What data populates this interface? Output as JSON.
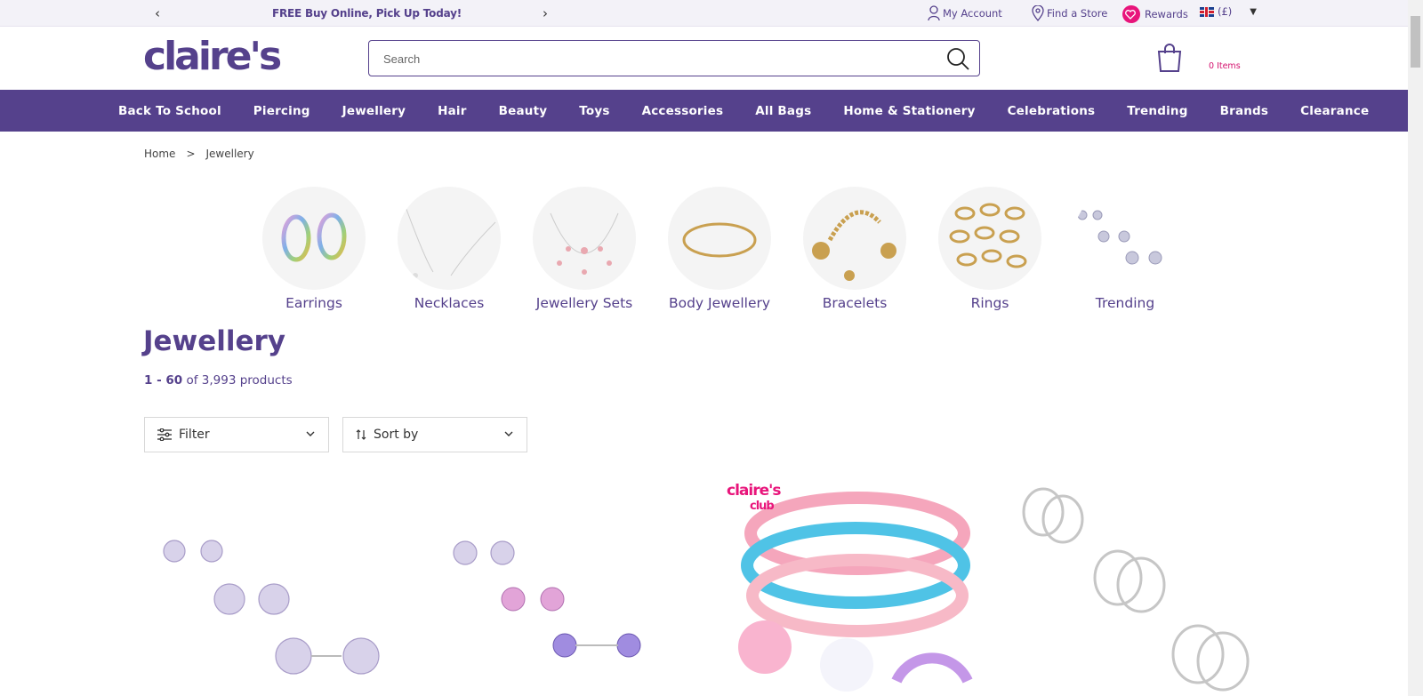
{
  "promo": {
    "message": "FREE Buy Online, Pick Up Today!",
    "prev": "‹",
    "next": "›"
  },
  "utility": {
    "account": "My Account",
    "store": "Find a Store",
    "rewards": "Rewards",
    "currency": "(£)"
  },
  "header": {
    "logo": "claire's",
    "search_placeholder": "Search",
    "cart_count": "0 Items"
  },
  "nav": [
    "Back To School",
    "Piercing",
    "Jewellery",
    "Hair",
    "Beauty",
    "Toys",
    "Accessories",
    "All Bags",
    "Home & Stationery",
    "Celebrations",
    "Trending",
    "Brands",
    "Clearance"
  ],
  "breadcrumb": {
    "home": "Home",
    "sep": ">",
    "current": "Jewellery"
  },
  "categories": [
    {
      "label": "Earrings"
    },
    {
      "label": "Necklaces"
    },
    {
      "label": "Jewellery Sets"
    },
    {
      "label": "Body Jewellery"
    },
    {
      "label": "Bracelets"
    },
    {
      "label": "Rings"
    },
    {
      "label": "Trending"
    }
  ],
  "listing": {
    "title": "Jewellery",
    "range": "1 - 60",
    "of_text": "of 3,993 products"
  },
  "controls": {
    "filter": "Filter",
    "sort": "Sort by"
  },
  "product_badge": {
    "line1": "claire's",
    "line2": "club"
  },
  "colors": {
    "brand": "#55418c",
    "accent": "#e8157b"
  }
}
